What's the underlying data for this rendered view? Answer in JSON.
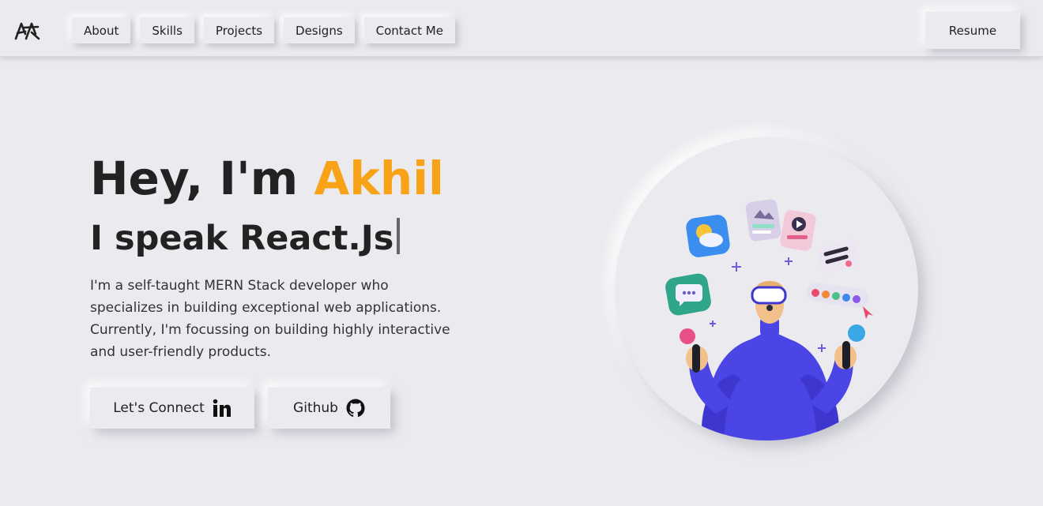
{
  "nav": {
    "logo": "logo",
    "links": [
      {
        "label": "About"
      },
      {
        "label": "Skills"
      },
      {
        "label": "Projects"
      },
      {
        "label": "Designs"
      },
      {
        "label": "Contact Me"
      }
    ],
    "resume_label": "Resume"
  },
  "hero": {
    "greeting": "Hey, I'm ",
    "name": "Akhil",
    "tagline": "I speak React.Js",
    "description": "I'm a self-taught MERN Stack developer who specializes in building exceptional web applications. Currently, I'm focussing on building highly interactive and user-friendly products.",
    "connect_label": "Let's Connect",
    "github_label": "Github"
  },
  "colors": {
    "background": "#ebebef",
    "accent": "#f8a317",
    "text": "#222222"
  },
  "icons": {
    "connect": "linkedin-icon",
    "github": "github-icon"
  }
}
